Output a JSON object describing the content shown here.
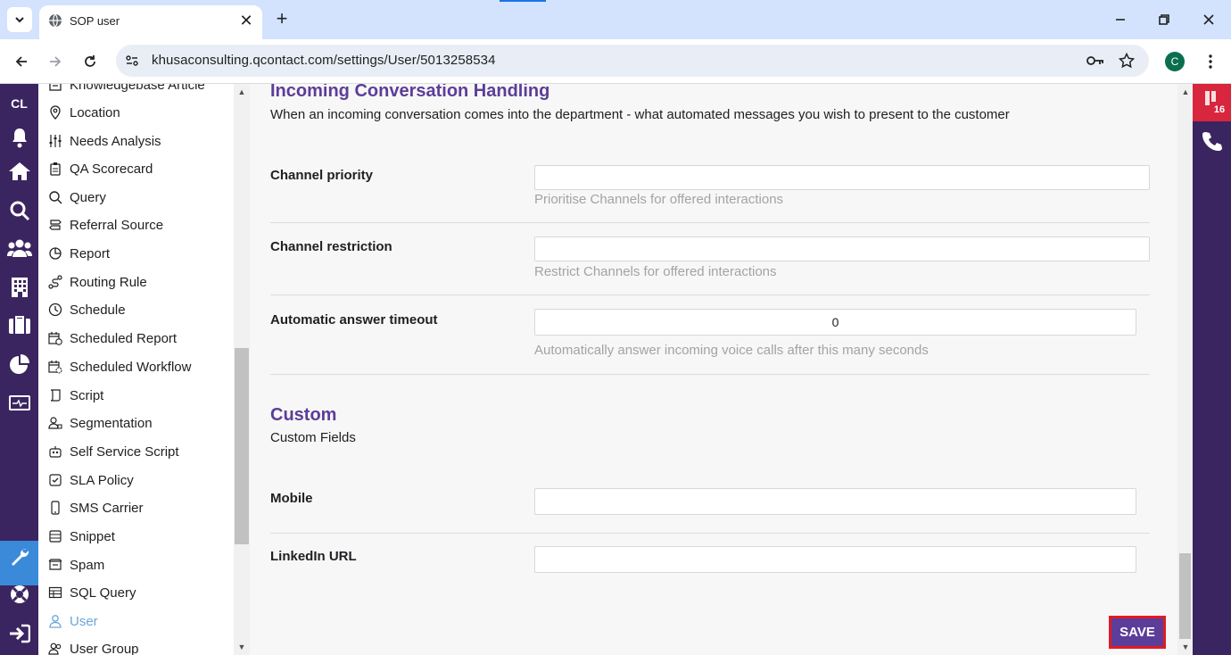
{
  "browser": {
    "tab_title": "SOP user",
    "url": "khusaconsulting.qcontact.com/settings/User/5013258534",
    "profile_initial": "C",
    "close_tab_glyph": "✕",
    "new_tab_glyph": "+"
  },
  "rail": {
    "logo": "CL",
    "icons": [
      "bell-icon",
      "home-icon",
      "search-icon",
      "people-icon",
      "building-icon",
      "briefcase-icon",
      "pie-chart-icon",
      "monitor-icon",
      "wrench-icon",
      "lifebuoy-icon",
      "logout-icon"
    ]
  },
  "sidebar": {
    "items": [
      {
        "label": "Knowledgebase Article",
        "icon": "article-icon"
      },
      {
        "label": "Location",
        "icon": "location-pin-icon"
      },
      {
        "label": "Needs Analysis",
        "icon": "sliders-icon"
      },
      {
        "label": "QA Scorecard",
        "icon": "clipboard-icon"
      },
      {
        "label": "Query",
        "icon": "search-icon"
      },
      {
        "label": "Referral Source",
        "icon": "signpost-icon"
      },
      {
        "label": "Report",
        "icon": "report-chart-icon"
      },
      {
        "label": "Routing Rule",
        "icon": "route-icon"
      },
      {
        "label": "Schedule",
        "icon": "clock-icon"
      },
      {
        "label": "Scheduled Report",
        "icon": "calendar-clock-icon"
      },
      {
        "label": "Scheduled Workflow",
        "icon": "calendar-gear-icon"
      },
      {
        "label": "Script",
        "icon": "script-icon"
      },
      {
        "label": "Segmentation",
        "icon": "users-segment-icon"
      },
      {
        "label": "Self Service Script",
        "icon": "robot-icon"
      },
      {
        "label": "SLA Policy",
        "icon": "sla-icon"
      },
      {
        "label": "SMS Carrier",
        "icon": "mobile-icon"
      },
      {
        "label": "Snippet",
        "icon": "snippet-icon"
      },
      {
        "label": "Spam",
        "icon": "spam-icon"
      },
      {
        "label": "SQL Query",
        "icon": "table-icon"
      },
      {
        "label": "User",
        "icon": "user-icon"
      },
      {
        "label": "User Group",
        "icon": "user-group-icon"
      }
    ],
    "active": "User"
  },
  "main": {
    "incoming": {
      "title": "Incoming Conversation Handling",
      "description": "When an incoming conversation comes into the department - what automated messages you wish to present to the customer"
    },
    "fields": {
      "channel_priority": {
        "label": "Channel priority",
        "value": "",
        "help": "Prioritise Channels for offered interactions"
      },
      "channel_restriction": {
        "label": "Channel restriction",
        "value": "",
        "help": "Restrict Channels for offered interactions"
      },
      "auto_answer": {
        "label": "Automatic answer timeout",
        "value": "0",
        "help": "Automatically answer incoming voice calls after this many seconds"
      }
    },
    "custom": {
      "title": "Custom",
      "description": "Custom Fields",
      "mobile": {
        "label": "Mobile",
        "value": ""
      },
      "linkedin": {
        "label": "LinkedIn URL",
        "value": ""
      }
    },
    "save_label": "SAVE"
  },
  "right_rail": {
    "badge": "16"
  },
  "colors": {
    "rail": "#3b2560",
    "accent": "#5c3d99",
    "active_link": "#6aa6d9",
    "highlight": "#e01b24",
    "badge": "#d7263d"
  }
}
